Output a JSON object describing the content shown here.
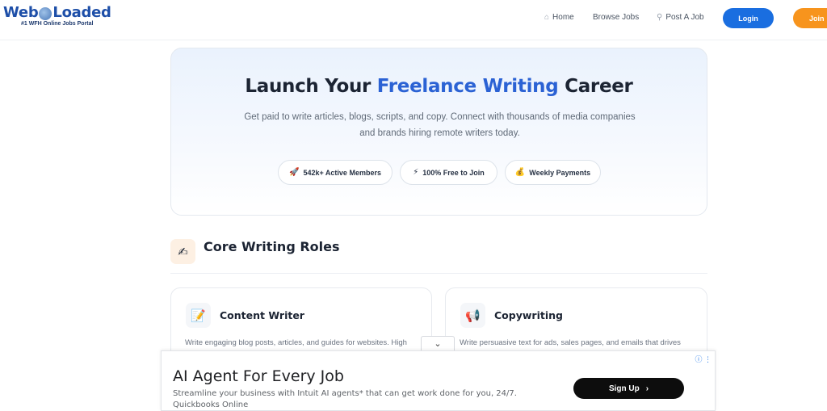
{
  "header": {
    "logo_left": "Web",
    "logo_right": "Loaded",
    "tagline": "#1 WFH Online Jobs Portal",
    "nav": {
      "home": "Home",
      "browse": "Browse Jobs",
      "post": "Post A Job",
      "login": "Login",
      "join": "Join"
    },
    "colors": {
      "login": "#1a6ee0",
      "join": "#f7941d",
      "brand": "#1e4fa8"
    }
  },
  "hero": {
    "title_pre": "Launch Your ",
    "title_accent": "Freelance Writing",
    "title_post": " Career",
    "subtitle": "Get paid to write articles, blogs, scripts, and copy. Connect with thousands of media companies and brands hiring remote writers today.",
    "pills": [
      {
        "icon": "rocket-icon",
        "label": "542k+ Active Members"
      },
      {
        "icon": "lightning-icon",
        "label": "100% Free to Join"
      },
      {
        "icon": "money-bag-icon",
        "label": "Weekly Payments"
      }
    ]
  },
  "section": {
    "icon": "writing-hand-icon",
    "title": "Core Writing Roles",
    "cards": [
      {
        "icon": "memo-icon",
        "title": "Content Writer",
        "desc": "Write engaging blog posts, articles, and guides for websites. High"
      },
      {
        "icon": "megaphone-icon",
        "title": "Copywriting",
        "desc": "Write persuasive text for ads, sales pages, and emails that drives"
      }
    ]
  },
  "ad": {
    "title": "AI Agent For Every Job",
    "desc": "Streamline your business with Intuit AI agents* that can get work done for you, 24/7.",
    "advertiser": "Quickbooks Online",
    "cta": "Sign Up"
  }
}
